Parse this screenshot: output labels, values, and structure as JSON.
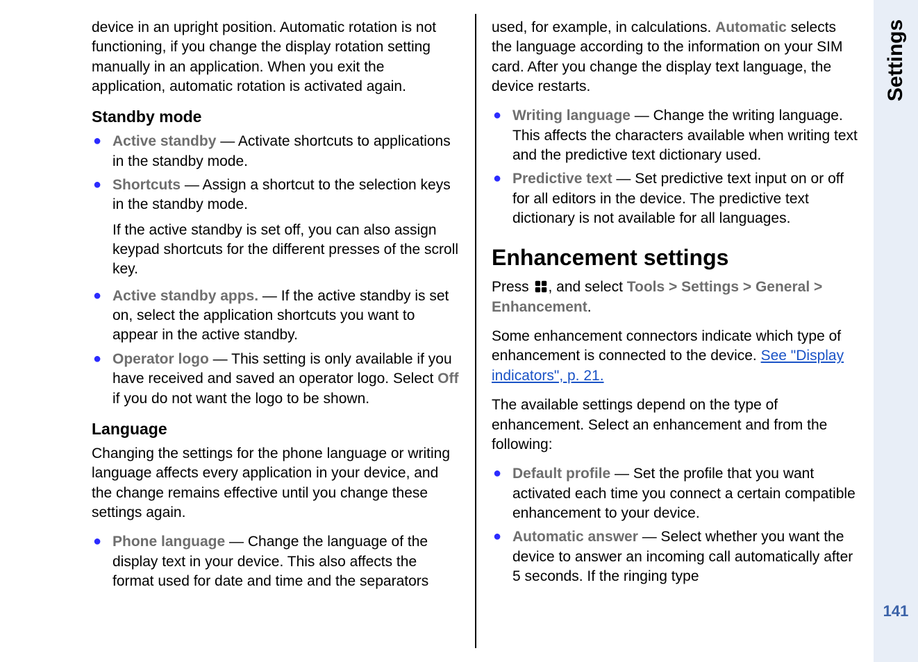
{
  "sideTab": {
    "label": "Settings",
    "pageNumber": "141"
  },
  "col1": {
    "intro": "device in an upright position. Automatic rotation is not functioning, if you change the display rotation setting manually in an application. When you exit the application, automatic rotation is activated again.",
    "standbyHead": "Standby mode",
    "standbyItems": {
      "a": {
        "label": "Active standby",
        "text": " — Activate shortcuts to applications in the standby mode."
      },
      "b": {
        "label": "Shortcuts",
        "text": " — Assign a shortcut to the selection keys in the standby mode."
      },
      "bExtra": "If the active standby is set off, you can also assign keypad shortcuts for the different presses of the scroll key.",
      "c": {
        "label": "Active standby apps.",
        "text": " — If the active standby is set on, select the application shortcuts you want to appear in the active standby."
      },
      "d": {
        "label": "Operator logo",
        "preText": " — This setting is only available if you have received and saved an operator logo. Select ",
        "off": "Off",
        "postText": " if you do not want the logo to be shown."
      }
    },
    "languageHead": "Language",
    "languageIntro": "Changing the settings for the phone language or writing language affects every application in your device, and the change remains effective until you change these settings again.",
    "langItems": {
      "a": {
        "label": "Phone language",
        "text": " — Change the language of the display text in your device. This also affects the format used for date and time and the separators"
      }
    }
  },
  "col2": {
    "langContPre": "used, for example, in calculations. ",
    "langContAuto": "Automatic",
    "langContPost": " selects the language according to the information on your SIM card. After you change the display text language, the device restarts.",
    "langItems": {
      "b": {
        "label": "Writing language",
        "text": " — Change the writing language. This affects the characters available when writing text and the predictive text dictionary used."
      },
      "c": {
        "label": "Predictive text",
        "text": " — Set predictive text input on or off for all editors in the device. The predictive text dictionary is not available for all languages."
      }
    },
    "enhHead": "Enhancement settings",
    "nav": {
      "press": "Press ",
      "andSelect": ", and select ",
      "tools": "Tools",
      "settings": "Settings",
      "general": "General",
      "enhancement": "Enhancement",
      "gt": ">",
      "period": "."
    },
    "enhP2a": "Some enhancement connectors indicate which type of enhancement is connected to the device. ",
    "enhLink": "See \"Display indicators\", p. 21.",
    "enhP3": "The available settings depend on the type of enhancement. Select an enhancement and from the following:",
    "enhItems": {
      "a": {
        "label": "Default profile",
        "text": " — Set the profile that you want activated each time you connect a certain compatible enhancement to your device."
      },
      "b": {
        "label": "Automatic answer",
        "text": " — Select whether you want the device to answer an incoming call automatically after 5 seconds. If the ringing type"
      }
    }
  }
}
